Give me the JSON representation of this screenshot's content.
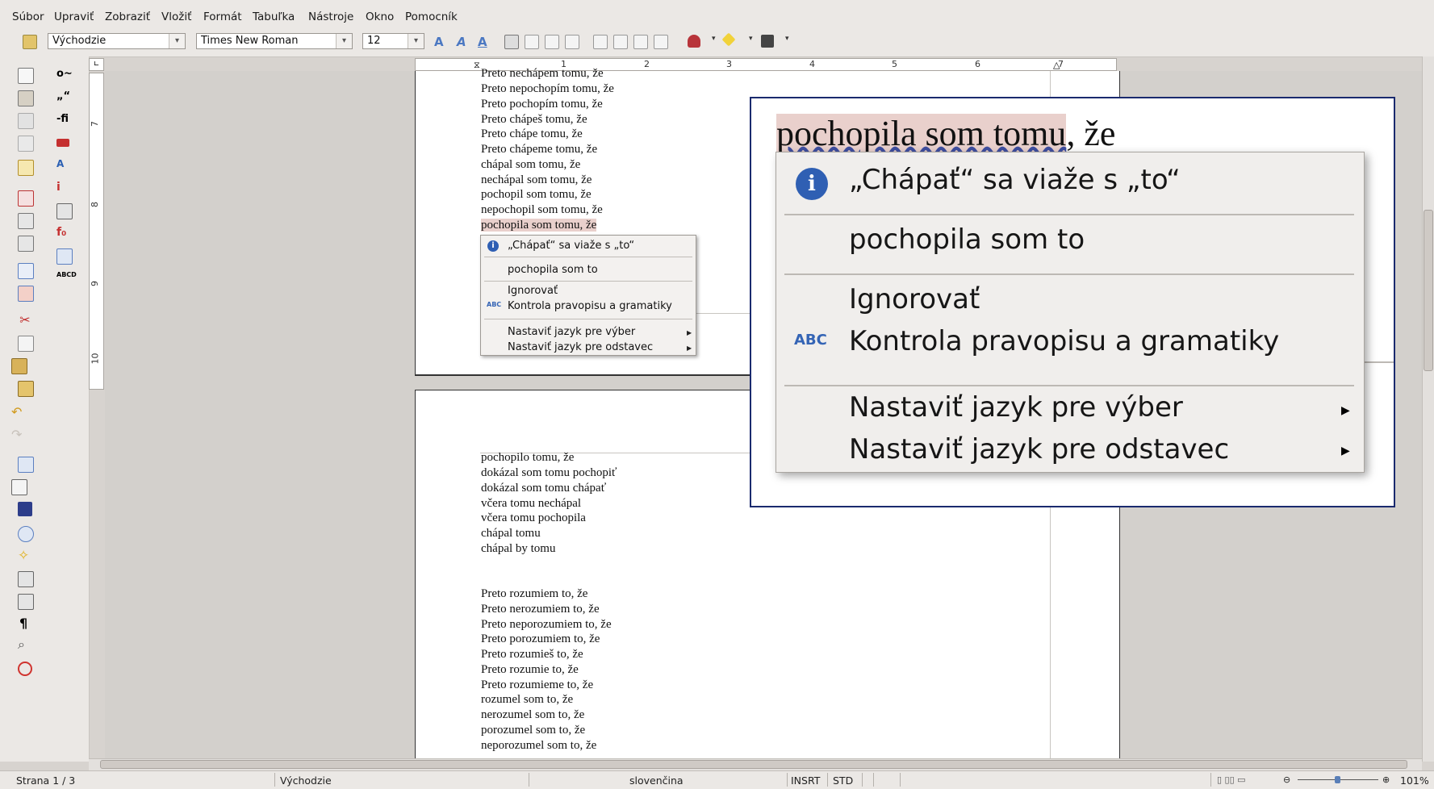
{
  "menu": {
    "items": [
      {
        "label": "Súbor"
      },
      {
        "label": "Upraviť"
      },
      {
        "label": "Zobraziť"
      },
      {
        "label": "Vložiť"
      },
      {
        "label": "Formát"
      },
      {
        "label": "Tabuľka"
      },
      {
        "label": "Nástroje"
      },
      {
        "label": "Okno"
      },
      {
        "label": "Pomocník"
      }
    ]
  },
  "toolbar": {
    "paragraph_style": "Východzie",
    "font_name": "Times New Roman",
    "font_size": "12"
  },
  "ruler": {
    "h_numbers": [
      "1",
      "2",
      "3",
      "4",
      "5",
      "6",
      "7"
    ],
    "v_numbers": [
      "7",
      "8",
      "9",
      "10"
    ]
  },
  "document": {
    "page1_lines": [
      "Preto nechápem tomu, že",
      "Preto nepochopím tomu, že",
      "Preto pochopím tomu, že",
      "Preto chápeš tomu, že",
      "Preto chápe tomu, že",
      "Preto chápeme tomu, že",
      "chápal som tomu, že",
      "nechápal som tomu, že",
      "pochopil som tomu, že",
      "nepochopil som tomu, že",
      "pochopila som tomu, že"
    ],
    "page2_lines_a": [
      "pochopilo tomu, že",
      "dokázal som tomu pochopiť",
      "dokázal som tomu chápať",
      "včera tomu nechápal",
      "včera tomu pochopila",
      "chápal tomu",
      "chápal by tomu"
    ],
    "page2_lines_b": [
      "Preto rozumiem to, že",
      "Preto nerozumiem to, že",
      "Preto neporozumiem to, že",
      "Preto porozumiem to, že",
      "Preto rozumieš to, že",
      "Preto rozumie to, že",
      "Preto rozumieme to, že",
      "rozumel som to, že",
      "nerozumel som to, že",
      "porozumel som to, že",
      "neporozumel som to, že"
    ]
  },
  "context_menu": {
    "info": "„Chápať“ sa viaže s „to“",
    "suggestion": "pochopila som to",
    "ignore": "Ignorovať",
    "spellcheck": "Kontrola pravopisu a gramatiky",
    "set_lang_selection": "Nastaviť jazyk pre výber",
    "set_lang_paragraph": "Nastaviť jazyk pre odstavec"
  },
  "zoom": {
    "highlighted": "pochopila som tomu",
    "rest": ", že"
  },
  "status": {
    "page": "Strana 1 / 3",
    "style": "Východzie",
    "language": "slovenčina",
    "insert_mode": "INSRT",
    "selection_mode": "STD",
    "zoom_level": "101%"
  },
  "colors": {
    "accent_border": "#1a2a6e",
    "info_icon": "#2f5fb3",
    "error_underline": "#3f4fa0"
  }
}
